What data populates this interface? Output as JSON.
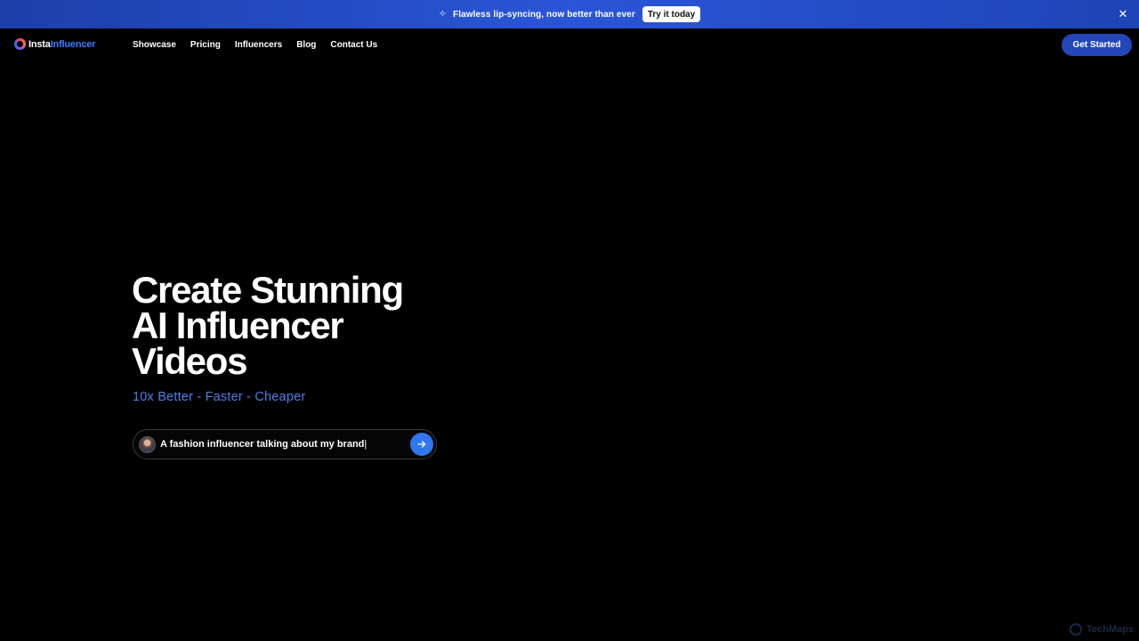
{
  "announcement": {
    "icon": "sparkle-icon",
    "message": "Flawless lip-syncing, now better than ever",
    "button_label": "Try it today",
    "close_icon": "close-icon"
  },
  "nav": {
    "logo_part1": "Insta",
    "logo_part2": "Influencer",
    "links": [
      "Showcase",
      "Pricing",
      "Influencers",
      "Blog",
      "Contact Us"
    ],
    "cta_label": "Get Started"
  },
  "hero": {
    "title_lines": [
      "Create Stunning",
      "AI Influencer",
      "Videos"
    ],
    "subtitle": "10x Better - Faster - Cheaper",
    "prompt_text": "A fashion influencer talking about my brand",
    "submit_icon": "arrow-right-icon"
  },
  "watermark": {
    "text": "TechMaps"
  },
  "colors": {
    "announce_bar": "#2a55d8",
    "accent": "#3c7bff",
    "subtitle": "#4a80e8",
    "cta": "#2347b9",
    "submit": "#2f78f0",
    "background": "#000000"
  }
}
